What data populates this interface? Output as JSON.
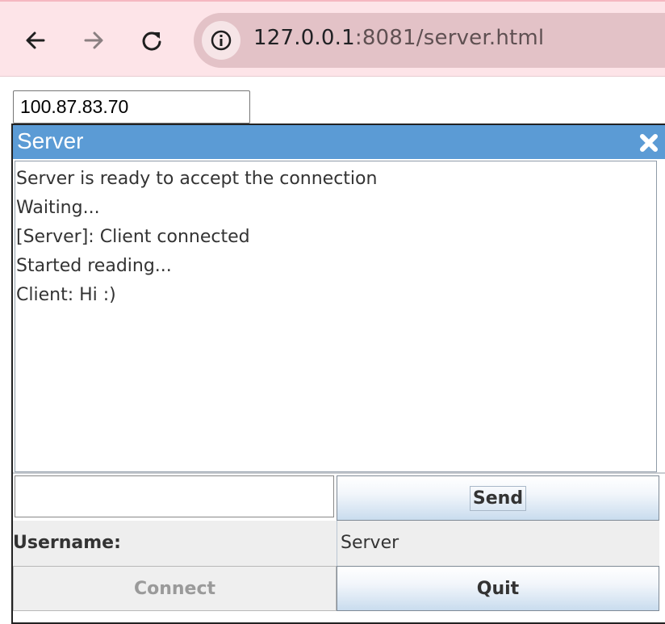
{
  "browser": {
    "url_host": "127.0.0.1",
    "url_rest": ":8081/server.html",
    "icons": {
      "back": "back-arrow-icon",
      "forward": "forward-arrow-icon",
      "reload": "reload-icon",
      "site_info": "info-icon"
    }
  },
  "page": {
    "ip_value": "100.87.83.70"
  },
  "window": {
    "title": "Server",
    "title_bar_color": "#5b9bd5",
    "close_icon": "close-icon",
    "messages": [
      "Server is ready to accept the connection",
      "Waiting...",
      "[Server]: Client connected",
      "Started reading...",
      "Client: Hi :)"
    ],
    "message_input_value": "",
    "send_label": "Send",
    "username_label": "Username:",
    "username_value": "Server",
    "connect_label": "Connect",
    "connect_enabled": false,
    "quit_label": "Quit"
  }
}
